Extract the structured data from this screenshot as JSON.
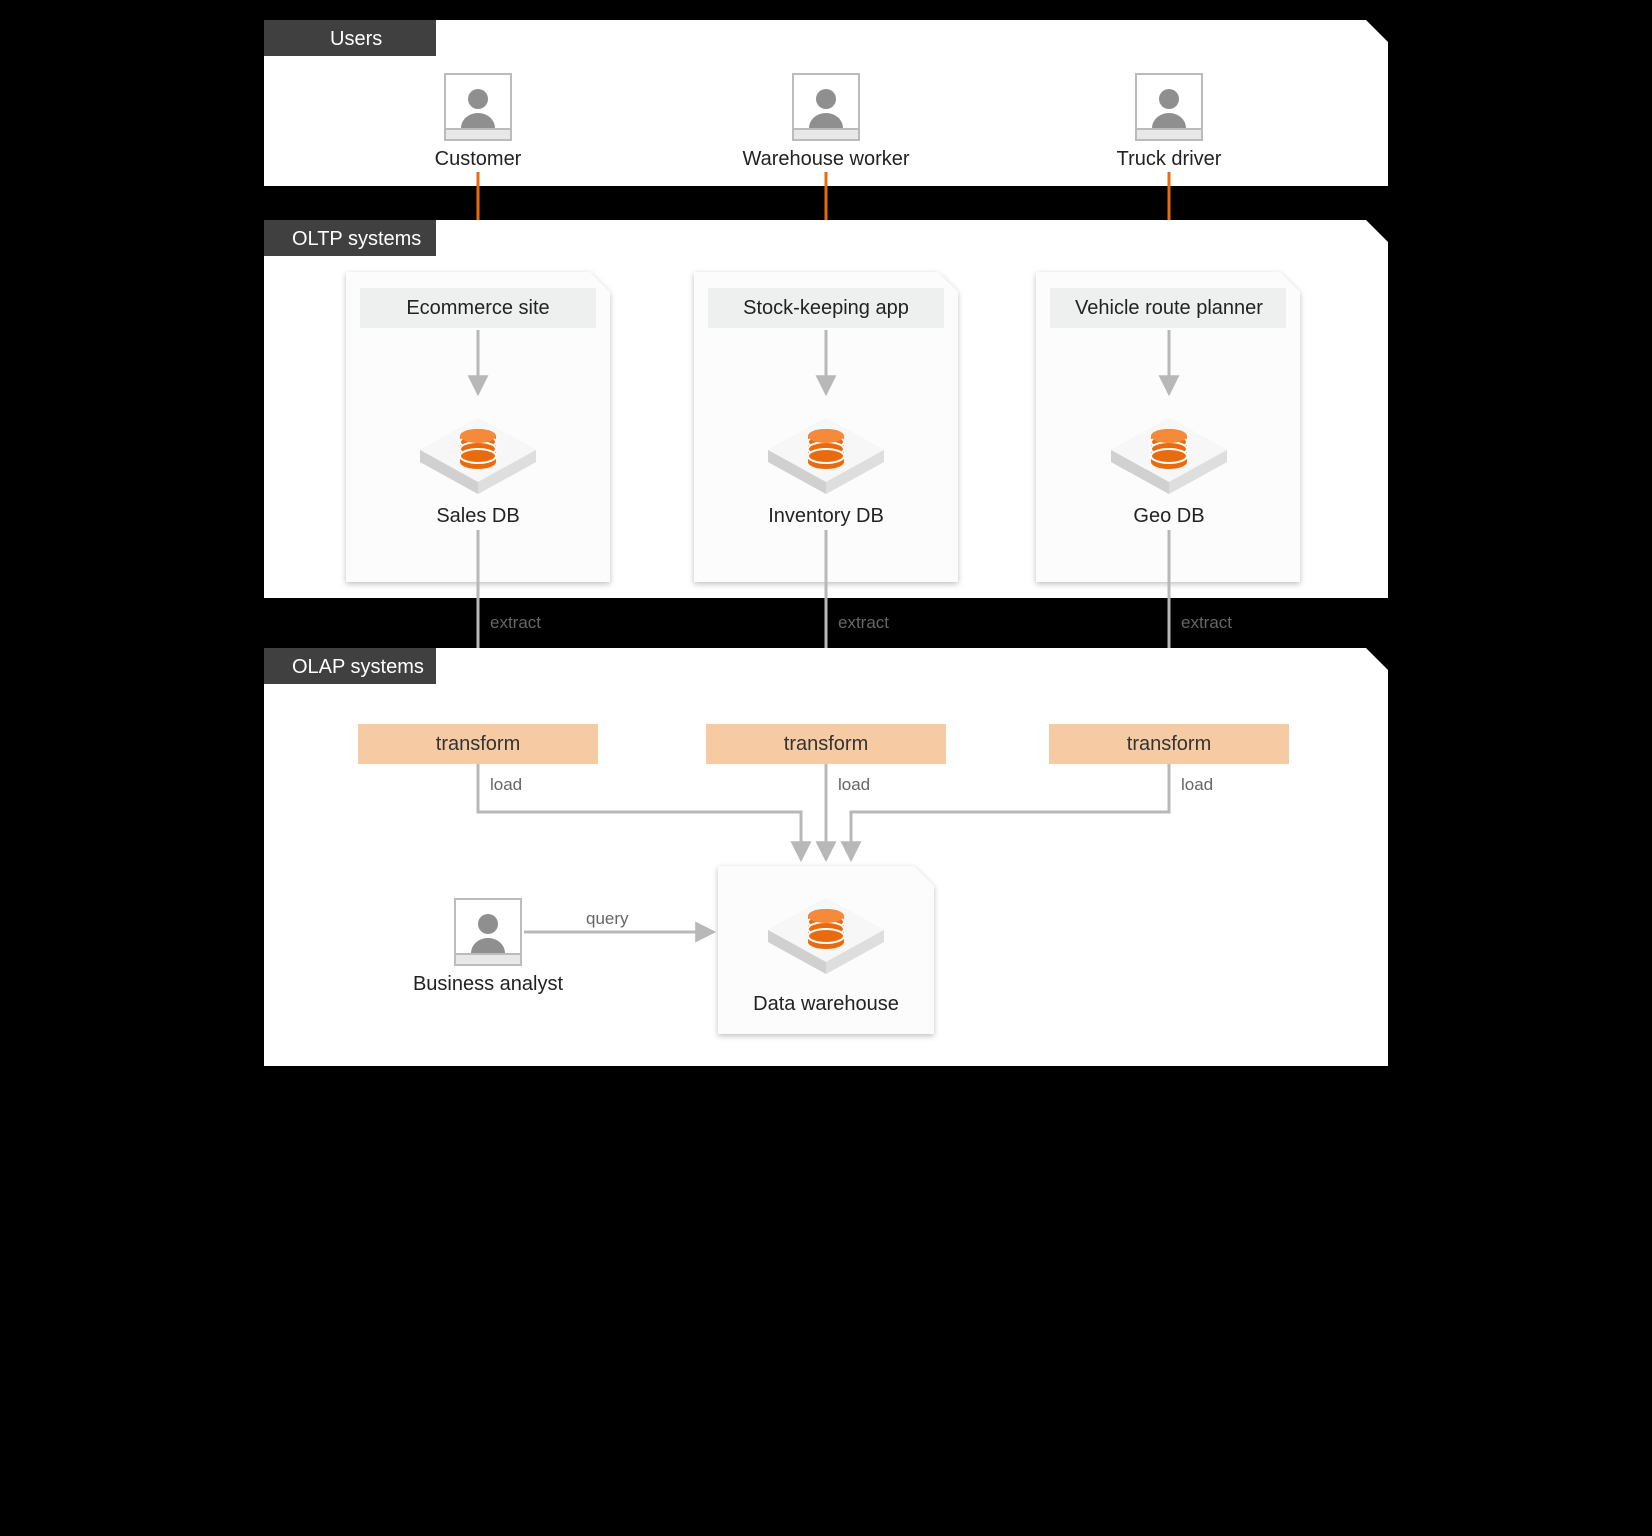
{
  "sections": {
    "users": "Users",
    "oltp": "OLTP systems",
    "olap": "OLAP systems"
  },
  "users": [
    {
      "label": "Customer"
    },
    {
      "label": "Warehouse worker"
    },
    {
      "label": "Truck driver"
    }
  ],
  "oltp": [
    {
      "app": "Ecommerce site",
      "db": "Sales DB"
    },
    {
      "app": "Stock-keeping app",
      "db": "Inventory DB"
    },
    {
      "app": "Vehicle route planner",
      "db": "Geo DB"
    }
  ],
  "etl": {
    "extract": "extract",
    "transform": "transform",
    "load": "load"
  },
  "analyst": {
    "label": "Business analyst",
    "action": "query"
  },
  "warehouse": "Data warehouse",
  "colors": {
    "accent": "#ea6b0d",
    "peach": "#f6cba3",
    "panelDark": "#404040",
    "panelMid": "#f4f5f5",
    "line": "#b8b8b8"
  }
}
